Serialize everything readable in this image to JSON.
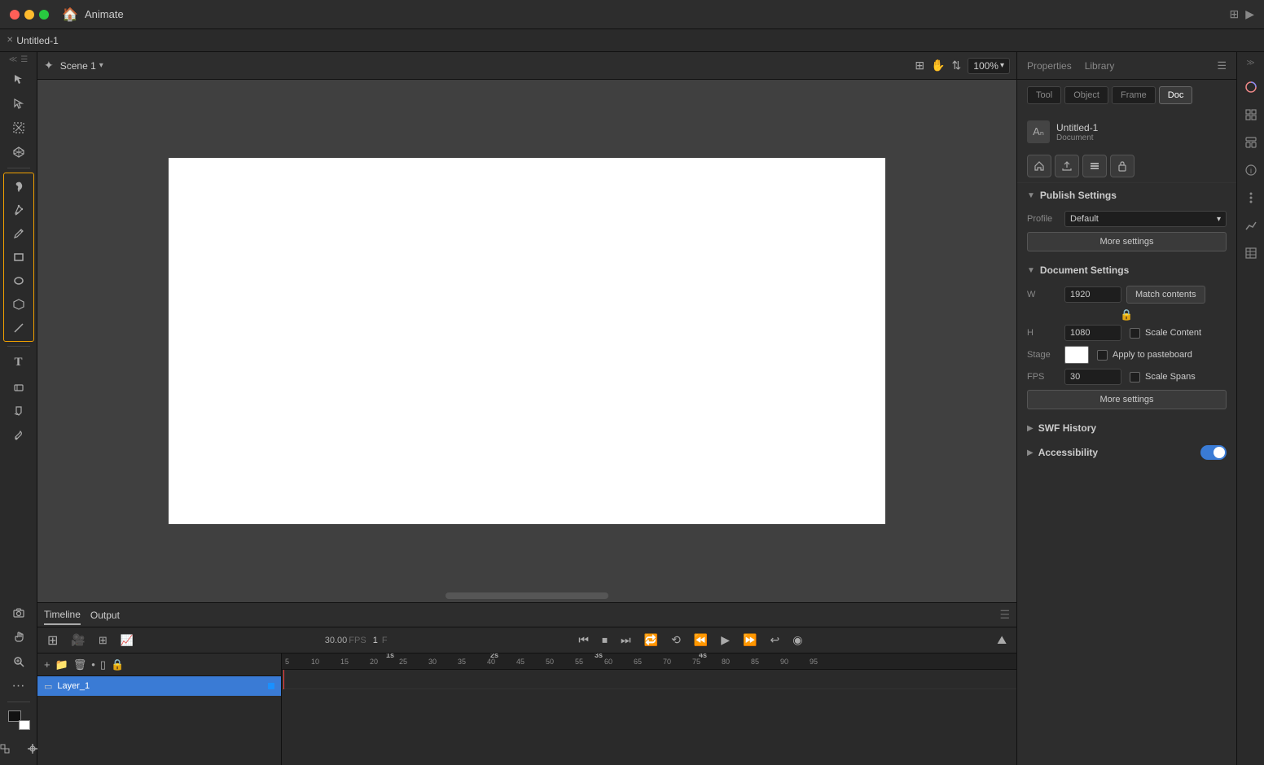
{
  "titlebar": {
    "app_name": "Animate",
    "tab_name": "Untitled-1",
    "win_btn_tile": "⊞",
    "win_btn_play": "▶"
  },
  "scene_bar": {
    "scene_label": "Scene 1",
    "zoom_label": "100%"
  },
  "panel": {
    "tabs": [
      {
        "label": "Tool",
        "active": false
      },
      {
        "label": "Object",
        "active": false
      },
      {
        "label": "Frame",
        "active": false
      },
      {
        "label": "Doc",
        "active": true
      }
    ],
    "doc_tabs": [
      {
        "label": "Tool",
        "key": "tool"
      },
      {
        "label": "Object",
        "key": "object"
      },
      {
        "label": "Frame",
        "key": "frame"
      },
      {
        "label": "Doc",
        "key": "doc"
      }
    ],
    "doc_name": "Untitled-1",
    "doc_sub": "Document",
    "publish_settings": {
      "header": "Publish Settings",
      "profile_label": "Profile",
      "profile_value": "Default",
      "more_settings_label": "More settings"
    },
    "document_settings": {
      "header": "Document Settings",
      "w_label": "W",
      "w_value": "1920",
      "h_label": "H",
      "h_value": "1080",
      "match_contents_label": "Match contents",
      "scale_content_label": "Scale Content",
      "stage_label": "Stage",
      "apply_pasteboard_label": "Apply to pasteboard",
      "fps_label": "FPS",
      "fps_value": "30",
      "scale_spans_label": "Scale Spans",
      "more_settings_label": "More settings"
    },
    "swf_history": {
      "header": "SWF History"
    },
    "accessibility": {
      "header": "Accessibility",
      "toggle": true
    }
  },
  "timeline": {
    "tabs": [
      {
        "label": "Timeline",
        "active": true
      },
      {
        "label": "Output",
        "active": false
      }
    ],
    "fps_value": "30.00",
    "fps_unit": "FPS",
    "frame_value": "1",
    "layer_name": "Layer_1",
    "ruler_marks": [
      "1s",
      "2s",
      "3s",
      "4s"
    ]
  },
  "toolbar": {
    "tools": [
      {
        "name": "selection-tool",
        "icon": "↖",
        "active": false
      },
      {
        "name": "subselection-tool",
        "icon": "↗",
        "active": false
      },
      {
        "name": "transform-tool",
        "icon": "⊡",
        "active": false
      },
      {
        "name": "3d-tool",
        "icon": "✦",
        "active": false
      },
      {
        "name": "paintbrush-tool",
        "icon": "✏",
        "active": false,
        "grouped": true
      },
      {
        "name": "pen-tool",
        "icon": "/",
        "active": false,
        "grouped": true
      },
      {
        "name": "pencil-tool",
        "icon": "✎",
        "active": false,
        "grouped": true
      },
      {
        "name": "rect-tool",
        "icon": "▭",
        "active": false,
        "grouped": true
      },
      {
        "name": "oval-tool",
        "icon": "◯",
        "active": false,
        "grouped": true
      },
      {
        "name": "poly-tool",
        "icon": "⬡",
        "active": false,
        "grouped": true
      },
      {
        "name": "line-tool",
        "icon": "╱",
        "active": false,
        "grouped": true
      },
      {
        "name": "text-tool",
        "icon": "T",
        "active": false
      },
      {
        "name": "eraser-tool",
        "icon": "◇",
        "active": false
      },
      {
        "name": "fill-tool",
        "icon": "◈",
        "active": false
      },
      {
        "name": "eyedropper-tool",
        "icon": "⊘",
        "active": false
      }
    ]
  },
  "colors": {
    "accent_blue": "#3a7bd5",
    "toolbar_group_border": "#f0a000",
    "bg_dark": "#1e1e1e",
    "bg_medium": "#2a2a2a",
    "bg_light": "#2d2d2d"
  }
}
